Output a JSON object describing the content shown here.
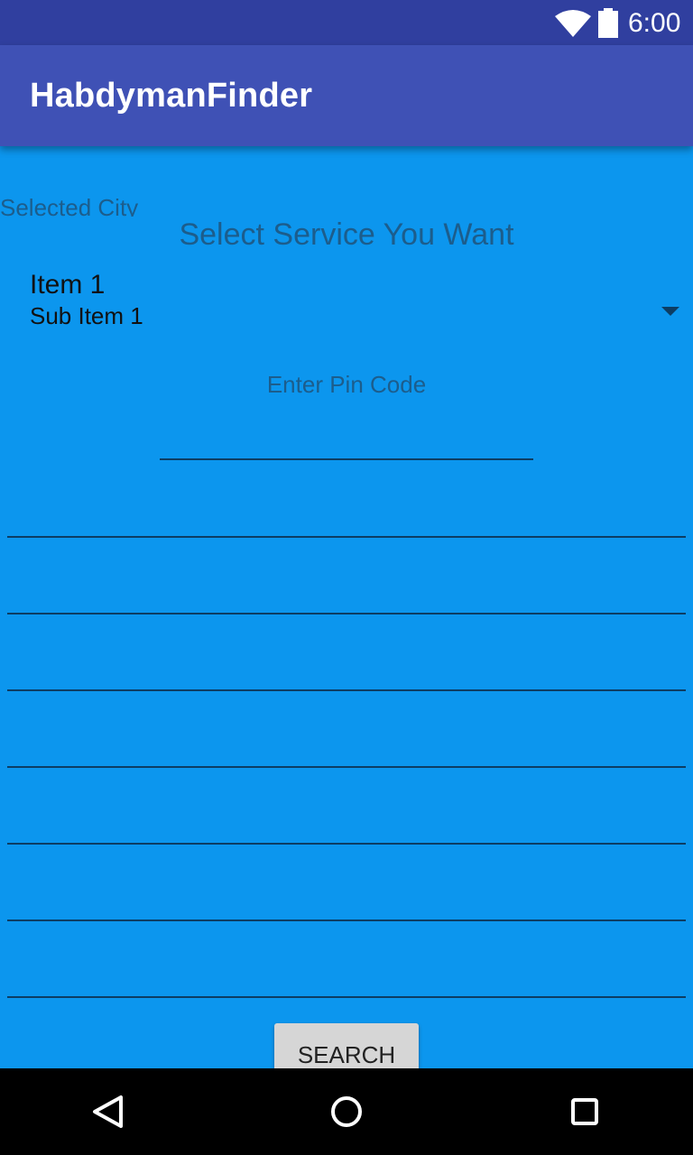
{
  "status_bar": {
    "time": "6:00",
    "wifi_icon": "wifi-icon",
    "battery_icon": "battery-icon"
  },
  "app_bar": {
    "title": "HabdymanFinder"
  },
  "content": {
    "selected_city_label": "Selected City",
    "service_heading": "Select Service You Want",
    "spinner": {
      "item_title": "Item 1",
      "item_sub": "Sub Item 1",
      "arrow_icon": "dropdown-arrow-icon"
    },
    "pin_code_label": "Enter Pin Code",
    "pin_code_value": "",
    "fields": [
      "",
      "",
      "",
      "",
      "",
      "",
      ""
    ],
    "search_label": "SEARCH"
  },
  "nav_bar": {
    "back_icon": "back-icon",
    "home_icon": "home-icon",
    "recents_icon": "recents-icon"
  },
  "colors": {
    "status_bar": "#303f9f",
    "app_bar": "#3f51b5",
    "background": "#0c96ee",
    "muted_text": "#1c5d8c",
    "button": "#d6d6d6"
  }
}
